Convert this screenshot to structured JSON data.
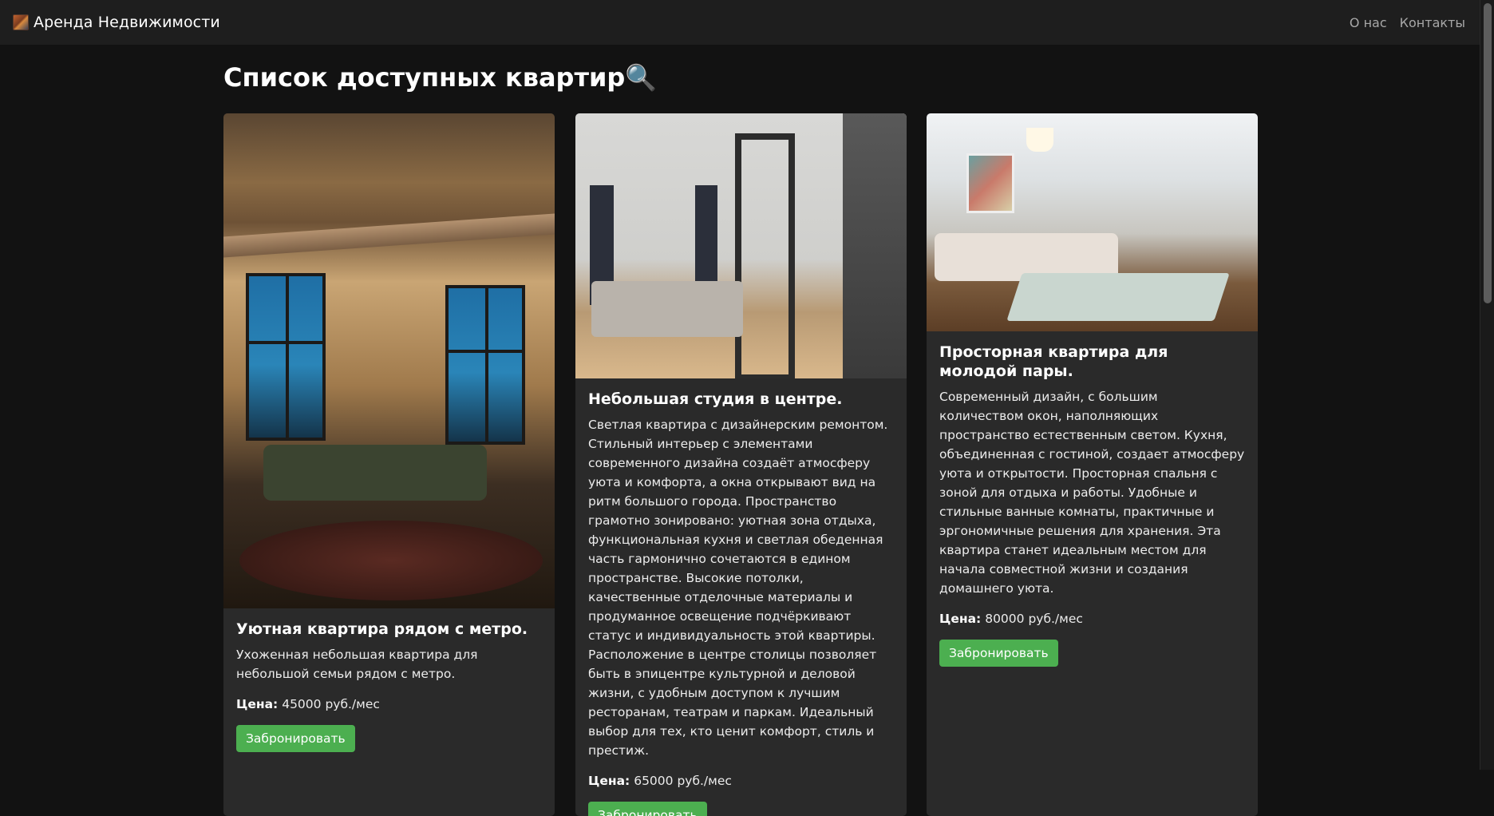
{
  "navbar": {
    "brand": "Аренда Недвижимости",
    "links": [
      "О нас",
      "Контакты"
    ]
  },
  "page": {
    "title": "Список доступных квартир",
    "title_emoji": "🔍"
  },
  "price_label": "Цена:",
  "book_label": "Забронировать",
  "listings": [
    {
      "title": "Уютная квартира рядом с метро.",
      "description": "Ухоженная небольшая квартира для небольшой семьи рядом с метро.",
      "price": "45000 руб./мес"
    },
    {
      "title": "Небольшая студия в центре.",
      "description": "Светлая квартира с дизайнерским ремонтом. Стильный интерьер с элементами современного дизайна создаёт атмосферу уюта и комфорта, а окна открывают вид на ритм большого города. Пространство грамотно зонировано: уютная зона отдыха, функциональная кухня и светлая обеденная часть гармонично сочетаются в едином пространстве. Высокие потолки, качественные отделочные материалы и продуманное освещение подчёркивают статус и индивидуальность этой квартиры. Расположение в центре столицы позволяет быть в эпицентре культурной и деловой жизни, с удобным доступом к лучшим ресторанам, театрам и паркам. Идеальный выбор для тех, кто ценит комфорт, стиль и престиж.",
      "price": "65000 руб./мес"
    },
    {
      "title": "Просторная квартира для молодой пары.",
      "description": "Современный дизайн, с большим количеством окон, наполняющих пространство естественным светом. Кухня, объединенная с гостиной, создает атмосферу уюта и открытости. Просторная спальня с зоной для отдыха и работы. Удобные и стильные ванные комнаты, практичные и эргономичные решения для хранения. Эта квартира станет идеальным местом для начала совместной жизни и создания домашнего уюта.",
      "price": "80000 руб./мес"
    }
  ],
  "colors": {
    "background": "#121212",
    "navbar": "#1e1e1e",
    "card": "#2a2a2a",
    "button": "#4caf50"
  }
}
